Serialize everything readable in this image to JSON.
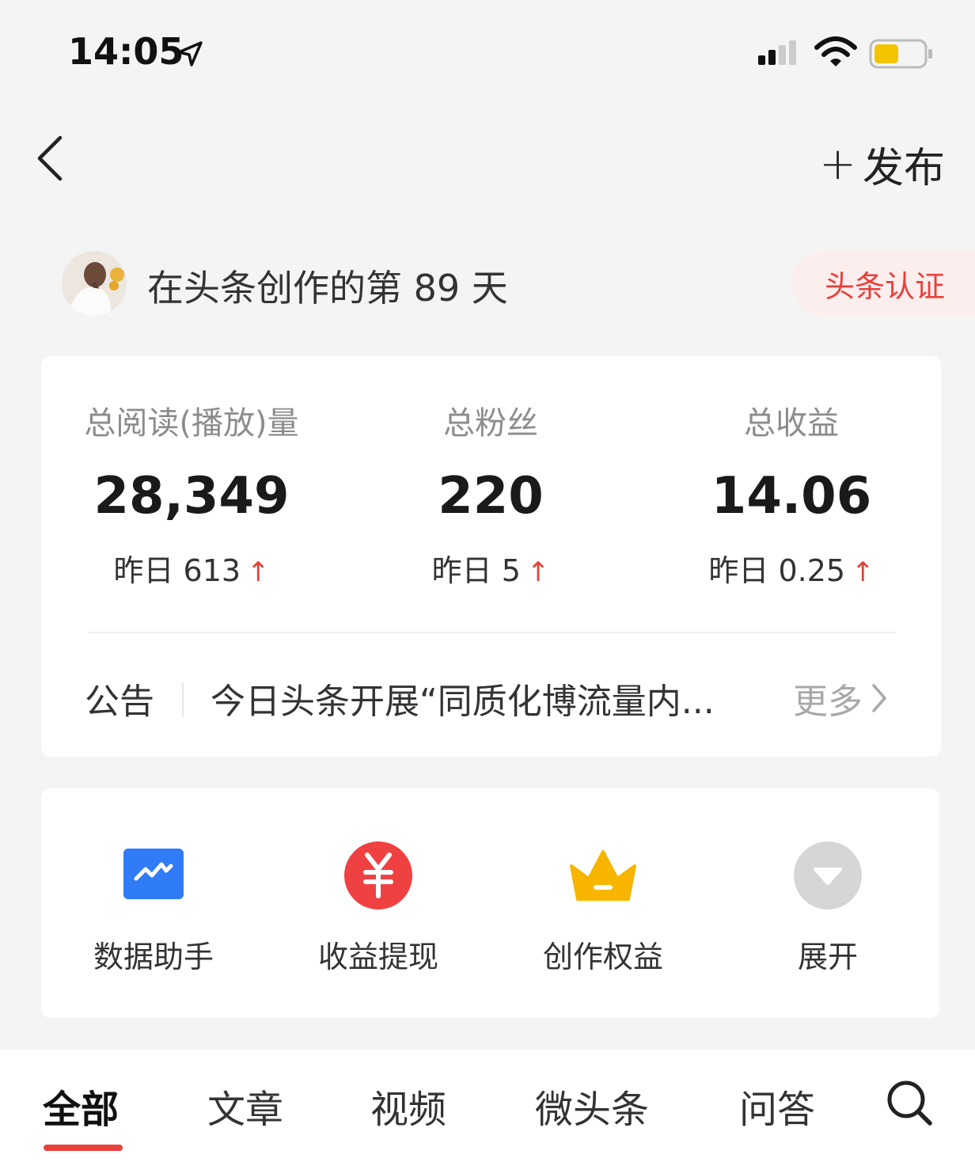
{
  "status_bar": {
    "time": "14:05"
  },
  "nav": {
    "publish_plus": "+",
    "publish_label": "发布"
  },
  "profile": {
    "days_text": "在头条创作的第 89 天",
    "cert_label": "头条认证"
  },
  "stats": [
    {
      "label": "总阅读(播放)量",
      "value": "28,349",
      "delta": "昨日 613"
    },
    {
      "label": "总粉丝",
      "value": "220",
      "delta": "昨日 5"
    },
    {
      "label": "总收益",
      "value": "14.06",
      "delta": "昨日 0.25"
    }
  ],
  "notice": {
    "label": "公告",
    "text": "今日头条开展“同质化博流量内...",
    "more": "更多"
  },
  "tools": [
    {
      "label": "数据助手",
      "icon": "chart-icon",
      "color": "#2f7cf6"
    },
    {
      "label": "收益提现",
      "icon": "yuan-icon",
      "color": "#f04142"
    },
    {
      "label": "创作权益",
      "icon": "crown-icon",
      "color": "#f7b500"
    },
    {
      "label": "展开",
      "icon": "expand-icon",
      "color": "#d6d6d6"
    }
  ],
  "tabs": [
    {
      "label": "全部",
      "active": true
    },
    {
      "label": "文章"
    },
    {
      "label": "视频"
    },
    {
      "label": "微头条"
    },
    {
      "label": "问答"
    }
  ],
  "colors": {
    "accent": "#e8403b",
    "badge_bg": "#fdeeee",
    "background": "#f4f4f4"
  }
}
